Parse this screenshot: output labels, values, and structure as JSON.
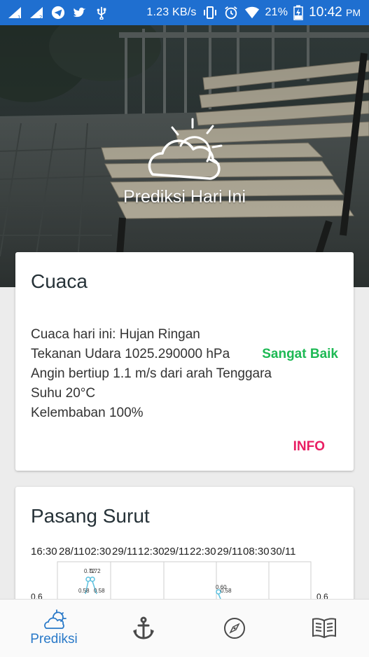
{
  "status_bar": {
    "network_speed": "1.23 KB/s",
    "battery": "21%",
    "time": "10:42",
    "ampm": "PM",
    "icons": [
      "signal-sim1-icon",
      "signal-sim2-icon",
      "telegram-icon",
      "twitter-icon",
      "usb-icon",
      "vibrate-icon",
      "alarm-icon",
      "wifi-icon",
      "battery-charging-icon"
    ]
  },
  "hero": {
    "title": "Prediksi Hari Ini",
    "icon": "cloud-sun-icon"
  },
  "weather_card": {
    "title": "Cuaca",
    "condition_line": "Cuaca hari ini: Hujan Ringan",
    "pressure_line": "Tekanan Udara 1025.290000 hPa",
    "quality": "Sangat Baik",
    "wind_line": "Angin bertiup 1.1 m/s dari arah Tenggara",
    "temp_line": "Suhu 20°C",
    "humidity_line": "Kelembaban 100%",
    "info_label": "INFO",
    "quality_color": "#1db954",
    "info_color": "#e91e63"
  },
  "tide_card": {
    "title": "Pasang Surut",
    "times": [
      "16:30",
      "28/11",
      "02:30",
      "29/11",
      "12:30",
      "29/11",
      "22:30",
      "29/11",
      "08:30",
      "30/11"
    ],
    "y_tick_left": "0.6",
    "y_tick_right": "0.6",
    "point_labels": [
      "0.72",
      "0.72",
      "0.58",
      "0.58",
      "0.60",
      "0.58"
    ]
  },
  "bottom_nav": {
    "items": [
      {
        "icon": "cloud-sun-icon",
        "label": "Prediksi",
        "active": true
      },
      {
        "icon": "anchor-icon",
        "label": "",
        "active": false
      },
      {
        "icon": "compass-icon",
        "label": "",
        "active": false
      },
      {
        "icon": "book-icon",
        "label": "",
        "active": false
      }
    ],
    "active_color": "#2979c8"
  }
}
